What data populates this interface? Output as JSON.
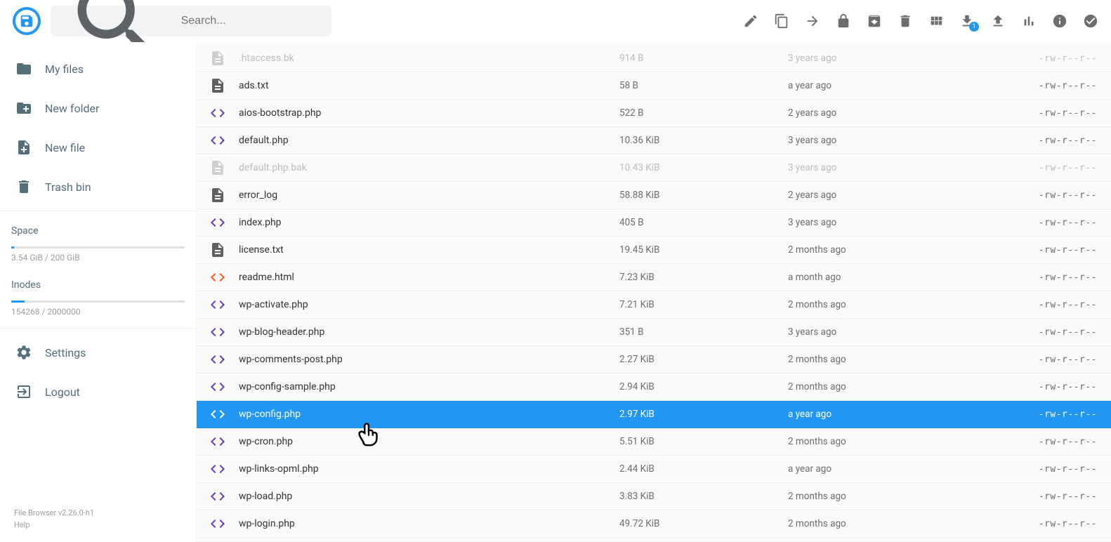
{
  "search": {
    "placeholder": "Search..."
  },
  "sidebar": {
    "nav": [
      {
        "label": "My files"
      },
      {
        "label": "New folder"
      },
      {
        "label": "New file"
      },
      {
        "label": "Trash bin"
      }
    ],
    "space": {
      "label": "Space",
      "text": "3.54 GiB / 200 GiB",
      "pct": 1.8
    },
    "inodes": {
      "label": "Inodes",
      "text": "154268 / 2000000",
      "pct": 7.7
    },
    "bottom": [
      {
        "label": "Settings"
      },
      {
        "label": "Logout"
      }
    ],
    "footer": {
      "version": "File Browser v2.26.0-h1",
      "help": "Help"
    }
  },
  "toolbar_badge": "1",
  "files": [
    {
      "icon": "file-gray",
      "name": ".htaccess.bk",
      "size": "914 B",
      "modified": "3 years ago",
      "perm": "-rw-r--r--",
      "dim": true
    },
    {
      "icon": "file",
      "name": "ads.txt",
      "size": "58 B",
      "modified": "a year ago",
      "perm": "-rw-r--r--"
    },
    {
      "icon": "code",
      "name": "aios-bootstrap.php",
      "size": "522 B",
      "modified": "2 years ago",
      "perm": "-rw-r--r--"
    },
    {
      "icon": "code",
      "name": "default.php",
      "size": "10.36 KiB",
      "modified": "3 years ago",
      "perm": "-rw-r--r--"
    },
    {
      "icon": "file-gray",
      "name": "default.php.bak",
      "size": "10.43 KiB",
      "modified": "3 years ago",
      "perm": "-rw-r--r--",
      "dim": true
    },
    {
      "icon": "file",
      "name": "error_log",
      "size": "58.88 KiB",
      "modified": "2 years ago",
      "perm": "-rw-r--r--"
    },
    {
      "icon": "code",
      "name": "index.php",
      "size": "405 B",
      "modified": "3 years ago",
      "perm": "-rw-r--r--"
    },
    {
      "icon": "file",
      "name": "license.txt",
      "size": "19.45 KiB",
      "modified": "2 months ago",
      "perm": "-rw-r--r--"
    },
    {
      "icon": "code-orange",
      "name": "readme.html",
      "size": "7.23 KiB",
      "modified": "a month ago",
      "perm": "-rw-r--r--"
    },
    {
      "icon": "code",
      "name": "wp-activate.php",
      "size": "7.21 KiB",
      "modified": "2 months ago",
      "perm": "-rw-r--r--"
    },
    {
      "icon": "code",
      "name": "wp-blog-header.php",
      "size": "351 B",
      "modified": "3 years ago",
      "perm": "-rw-r--r--"
    },
    {
      "icon": "code",
      "name": "wp-comments-post.php",
      "size": "2.27 KiB",
      "modified": "2 months ago",
      "perm": "-rw-r--r--"
    },
    {
      "icon": "code",
      "name": "wp-config-sample.php",
      "size": "2.94 KiB",
      "modified": "2 months ago",
      "perm": "-rw-r--r--"
    },
    {
      "icon": "code-white",
      "name": "wp-config.php",
      "size": "2.97 KiB",
      "modified": "a year ago",
      "perm": "-rw-r--r--",
      "selected": true
    },
    {
      "icon": "code",
      "name": "wp-cron.php",
      "size": "5.51 KiB",
      "modified": "2 months ago",
      "perm": "-rw-r--r--"
    },
    {
      "icon": "code",
      "name": "wp-links-opml.php",
      "size": "2.44 KiB",
      "modified": "a year ago",
      "perm": "-rw-r--r--"
    },
    {
      "icon": "code",
      "name": "wp-load.php",
      "size": "3.83 KiB",
      "modified": "2 months ago",
      "perm": "-rw-r--r--"
    },
    {
      "icon": "code",
      "name": "wp-login.php",
      "size": "49.72 KiB",
      "modified": "2 months ago",
      "perm": "-rw-r--r--"
    }
  ]
}
